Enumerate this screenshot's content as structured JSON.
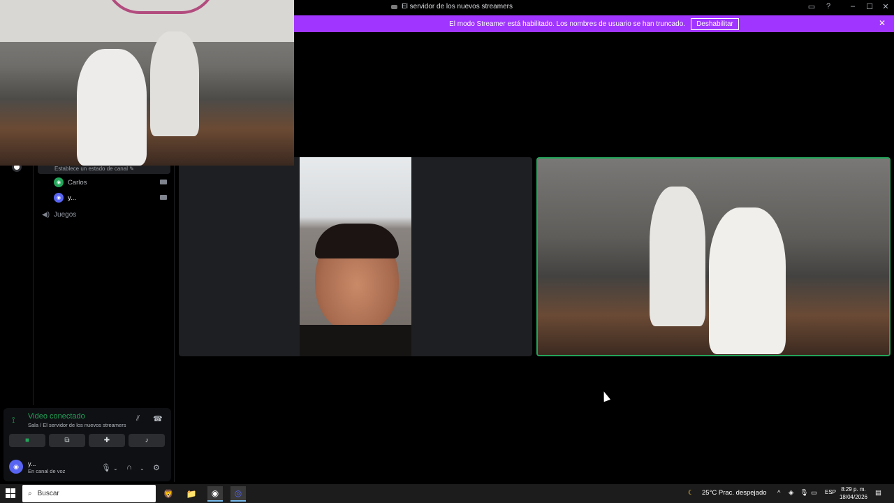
{
  "window": {
    "title": "El servidor de los nuevos streamers"
  },
  "banner": {
    "text": "El modo Streamer está habilitado. Los nombres de usuario se han truncado.",
    "button": "Deshabilitar"
  },
  "sidebar": {
    "status_hint": "Establece un estado de canal",
    "members": [
      {
        "name": "Carlos",
        "color": "#23a55a"
      },
      {
        "name": "y...",
        "color": "#5865f2"
      }
    ],
    "voice_channel": "Juegos"
  },
  "voice_panel": {
    "status": "Video conectado",
    "location": "Sala / El servidor de los nuevos streamers",
    "user_name": "y...",
    "user_status": "En canal de voz"
  },
  "taskbar": {
    "search_placeholder": "Buscar",
    "weather": "25°C  Prac. despejado",
    "language": "ESP",
    "time": "8:29 p. m.",
    "date": "18/04/2026"
  },
  "colors": {
    "banner": "#a035ff",
    "connected": "#23a55a",
    "brand": "#5865f2"
  }
}
